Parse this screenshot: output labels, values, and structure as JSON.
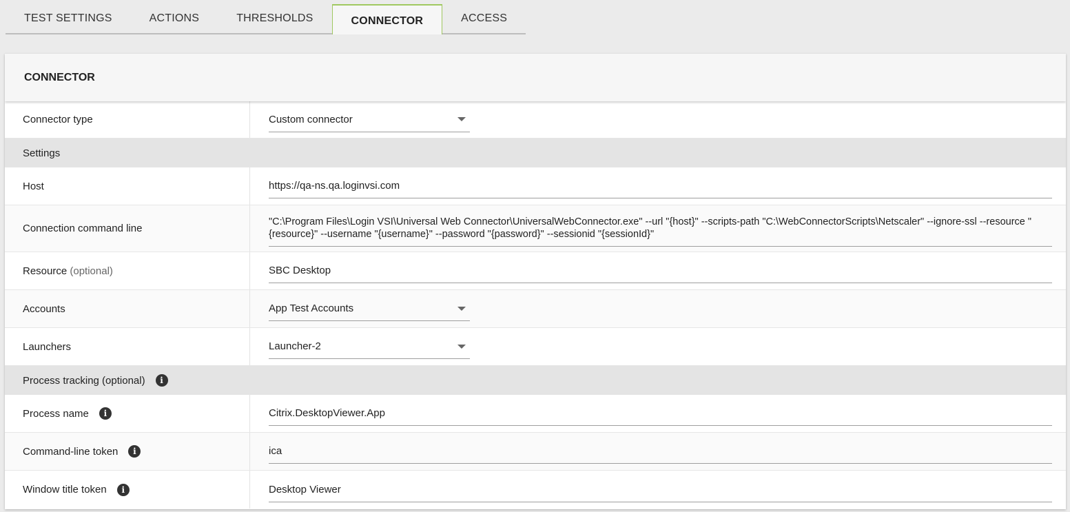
{
  "tabs": [
    {
      "label": "TEST SETTINGS",
      "active": false
    },
    {
      "label": "ACTIONS",
      "active": false
    },
    {
      "label": "THRESHOLDS",
      "active": false
    },
    {
      "label": "CONNECTOR",
      "active": true
    },
    {
      "label": "ACCESS",
      "active": false
    }
  ],
  "panel": {
    "title": "CONNECTOR"
  },
  "connector_type": {
    "label": "Connector type",
    "value": "Custom connector"
  },
  "settings_section": "Settings",
  "host": {
    "label": "Host",
    "value": "https://qa-ns.qa.loginvsi.com"
  },
  "command_line": {
    "label": "Connection command line",
    "value": " \"C:\\Program Files\\Login VSI\\Universal Web Connector\\UniversalWebConnector.exe\" --url \"{host}\" --scripts-path \"C:\\WebConnectorScripts\\Netscaler\" --ignore-ssl --resource \"{resource}\" --username \"{username}\" --password \"{password}\" --sessionid \"{sessionId}\""
  },
  "resource": {
    "label": "Resource",
    "optional": "(optional)",
    "value": "SBC Desktop"
  },
  "accounts": {
    "label": "Accounts",
    "value": "App Test Accounts"
  },
  "launchers": {
    "label": "Launchers",
    "value": "Launcher-2"
  },
  "process_section": {
    "label": "Process tracking (optional)"
  },
  "process_name": {
    "label": "Process name",
    "value": "Citrix.DesktopViewer.App"
  },
  "command_token": {
    "label": "Command-line token",
    "value": "ica"
  },
  "window_token": {
    "label": "Window title token",
    "value": "Desktop Viewer"
  },
  "icons": {
    "info": "info-icon",
    "dropdown": "chevron-down-icon"
  }
}
